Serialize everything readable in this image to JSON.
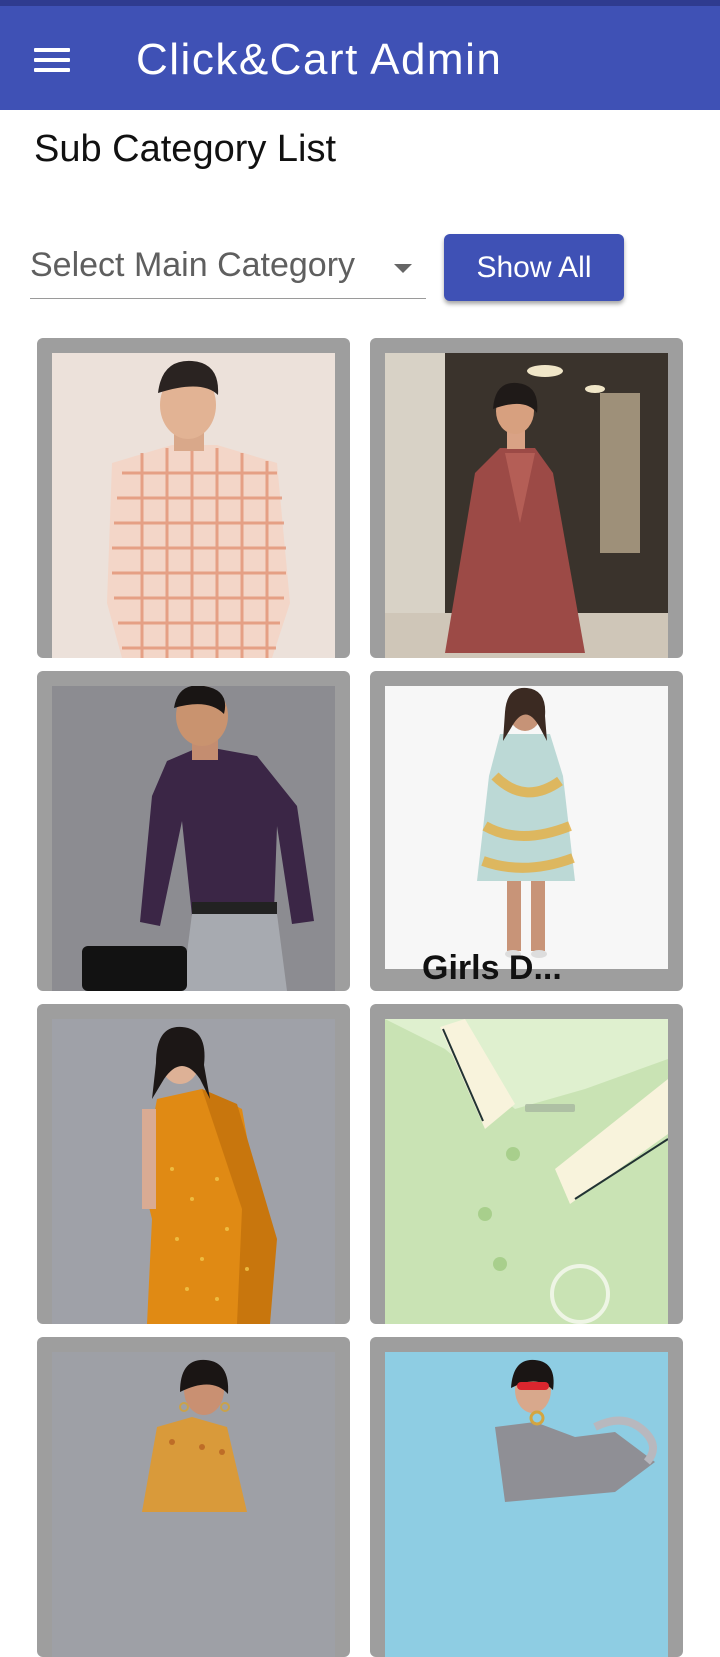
{
  "app": {
    "title": "Click&Cart Admin"
  },
  "page": {
    "title": "Sub Category List"
  },
  "filter": {
    "select_label": "Select Main Category",
    "show_all_label": "Show All"
  },
  "subcategories": [
    {
      "image": "man-checked-shirt"
    },
    {
      "image": "woman-maroon-kurta-dress"
    },
    {
      "image": "man-purple-formal-shirt"
    },
    {
      "image": "girl-printed-dress",
      "label": "Girls D..."
    },
    {
      "image": "woman-orange-saree"
    },
    {
      "image": "green-polo-tshirt"
    },
    {
      "image": "woman-ethnic-kurti"
    },
    {
      "image": "woman-grey-ruffle-top"
    }
  ],
  "colors": {
    "appbar": "#3f51b5",
    "card": "#9e9e9e",
    "accent": "#3f51b5"
  }
}
